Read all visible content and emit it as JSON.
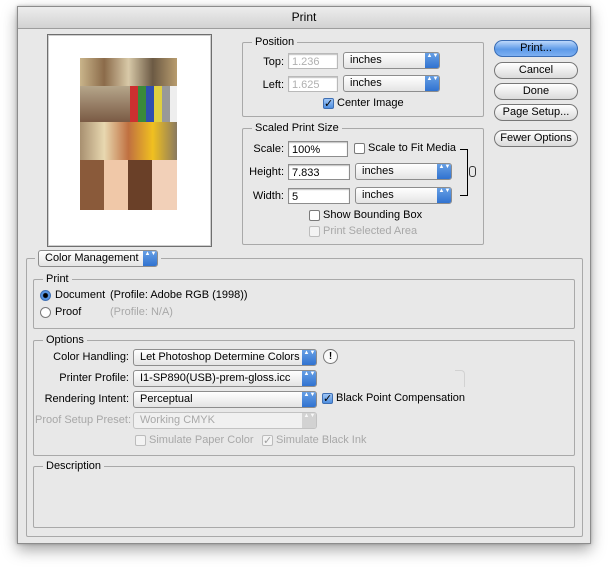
{
  "window": {
    "title": "Print"
  },
  "buttons": {
    "print": "Print...",
    "cancel": "Cancel",
    "done": "Done",
    "page_setup": "Page Setup...",
    "fewer_options": "Fewer Options"
  },
  "position": {
    "label": "Position",
    "top_label": "Top:",
    "top_value": "1.236",
    "top_unit": "inches",
    "left_label": "Left:",
    "left_value": "1.625",
    "left_unit": "inches",
    "center_image": "Center Image"
  },
  "scaled": {
    "label": "Scaled Print Size",
    "scale_label": "Scale:",
    "scale_value": "100%",
    "scale_to_fit": "Scale to Fit Media",
    "height_label": "Height:",
    "height_value": "7.833",
    "height_unit": "inches",
    "width_label": "Width:",
    "width_value": "5",
    "width_unit": "inches",
    "show_bounding_box": "Show Bounding Box",
    "print_selected_area": "Print Selected Area"
  },
  "color_management": {
    "selector": "Color Management",
    "print_group": "Print",
    "document_label": "Document",
    "document_profile": "(Profile: Adobe RGB (1998))",
    "proof_label": "Proof",
    "proof_profile": "(Profile: N/A)"
  },
  "options": {
    "label": "Options",
    "color_handling_label": "Color Handling:",
    "color_handling_value": "Let Photoshop Determine Colors",
    "info_glyph": "!",
    "printer_profile_label": "Printer Profile:",
    "printer_profile_value": "I1-SP890(USB)-prem-gloss.icc",
    "rendering_intent_label": "Rendering Intent:",
    "rendering_intent_value": "Perceptual",
    "black_point": "Black Point Compensation",
    "proof_setup_label": "Proof Setup Preset:",
    "proof_setup_value": "Working CMYK",
    "simulate_paper": "Simulate Paper Color",
    "simulate_black": "Simulate Black Ink"
  },
  "description": {
    "label": "Description"
  },
  "icons": {
    "checkmark": "✓",
    "popup_arrows": "▲▼"
  }
}
